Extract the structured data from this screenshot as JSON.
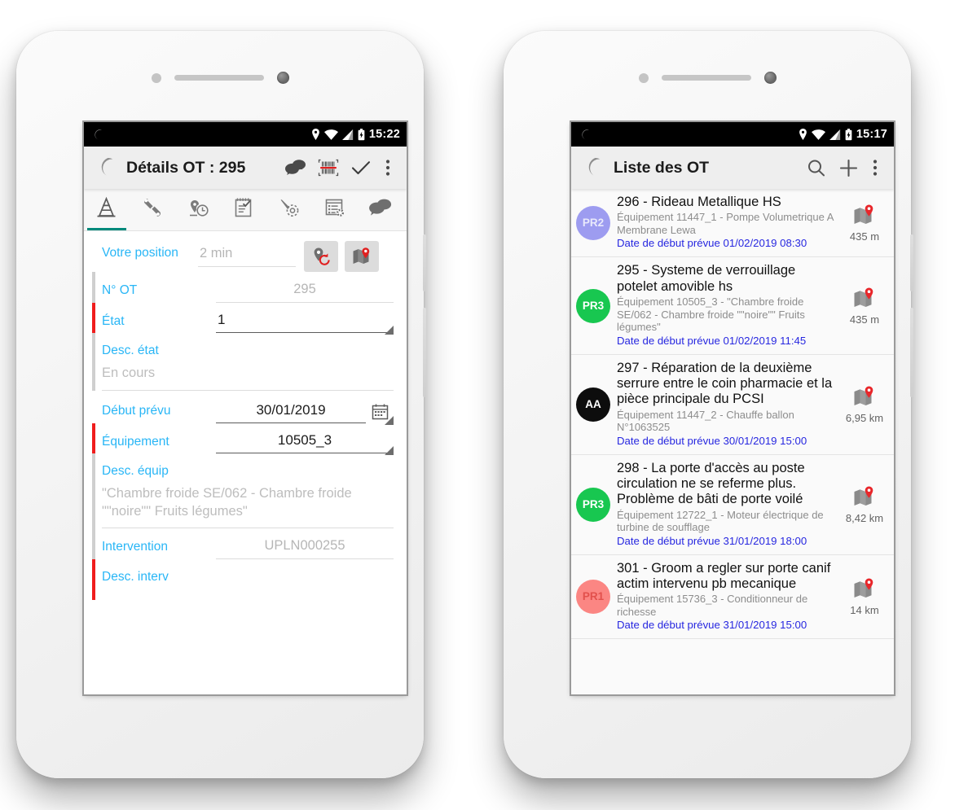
{
  "left_phone": {
    "status_bar": {
      "time": "15:22",
      "icons": [
        "location-pin",
        "wifi",
        "cellular-signal",
        "battery-charging"
      ]
    },
    "appbar": {
      "title": "Détails OT : 295",
      "actions": [
        {
          "name": "chat-icon",
          "label": "Chat"
        },
        {
          "name": "barcode-scan-icon",
          "label": "Scanner"
        },
        {
          "name": "check-icon",
          "label": "Valider"
        },
        {
          "name": "overflow-menu-icon",
          "label": "Plus"
        }
      ]
    },
    "tabs": [
      {
        "name": "tab-traffic-cone",
        "active": true
      },
      {
        "name": "tab-wrench",
        "active": false
      },
      {
        "name": "tab-location-history",
        "active": false
      },
      {
        "name": "tab-notepad",
        "active": false
      },
      {
        "name": "tab-tools",
        "active": false
      },
      {
        "name": "tab-list-settings",
        "active": false
      },
      {
        "name": "tab-chat",
        "active": false
      }
    ],
    "form": {
      "position": {
        "label": "Votre position",
        "value": "2 min",
        "refresh_button": "refresh-location-icon",
        "map_button": "map-pin-icon"
      },
      "fields": [
        {
          "label": "N° OT",
          "value": "295",
          "marker": "opt",
          "style": "ghost",
          "caret": false
        },
        {
          "label": "État",
          "value": "1",
          "marker": "req",
          "style": "value",
          "caret": true
        },
        {
          "label": "Début prévu",
          "value": "30/01/2019",
          "marker": "none",
          "style": "value",
          "caret": true,
          "calendar": true
        },
        {
          "label": "Équipement",
          "value": "10505_3",
          "marker": "req",
          "style": "value",
          "caret": true
        },
        {
          "label": "Intervention",
          "value": "UPLN000255",
          "marker": "opt",
          "style": "ghost",
          "caret": false
        }
      ],
      "desc_etat": {
        "label": "Desc. état",
        "value": "En cours",
        "marker": "opt"
      },
      "desc_equip": {
        "label": "Desc. équip",
        "value": "\"Chambre froide SE/062 - Chambre froide \"\"noire\"\" Fruits légumes\"",
        "marker": "opt"
      },
      "desc_interv": {
        "label": "Desc. interv",
        "marker": "req"
      }
    }
  },
  "right_phone": {
    "status_bar": {
      "time": "15:17",
      "icons": [
        "location-pin",
        "wifi",
        "cellular-signal",
        "battery-charging"
      ]
    },
    "appbar": {
      "title": "Liste des OT",
      "actions": [
        {
          "name": "search-icon",
          "label": "Rechercher"
        },
        {
          "name": "add-icon",
          "label": "Ajouter"
        },
        {
          "name": "overflow-menu-icon",
          "label": "Plus"
        }
      ]
    },
    "list": [
      {
        "avatar": "PR2",
        "avatar_bg": "#9d9cf0",
        "avatar_fg": "#e9e9fb",
        "title": "296 - Rideau Metallique HS",
        "equipment": "Équipement 11447_1 - Pompe Volumetrique A Membrane Lewa",
        "date": "Date de début prévue 01/02/2019 08:30",
        "distance": "435 m"
      },
      {
        "avatar": "PR3",
        "avatar_bg": "#18c750",
        "avatar_fg": "#ffffff",
        "title": "295 - Systeme de verrouillage potelet amovible hs",
        "equipment": "Équipement 10505_3 - \"Chambre froide SE/062 - Chambre froide \"\"noire\"\" Fruits légumes\"",
        "date": "Date de début prévue 01/02/2019 11:45",
        "distance": "435 m"
      },
      {
        "avatar": "AA",
        "avatar_bg": "#0d0d0d",
        "avatar_fg": "#ffffff",
        "title": "297 - Réparation de la deuxième serrure entre le coin pharmacie et la pièce principale du PCSI",
        "equipment": "Équipement 11447_2 - Chauffe ballon N°1063525",
        "date": "Date de début prévue 30/01/2019 15:00",
        "distance": "6,95 km"
      },
      {
        "avatar": "PR3",
        "avatar_bg": "#18c750",
        "avatar_fg": "#ffffff",
        "title": "298 - La porte d'accès au poste circulation ne se referme plus. Problème de bâti de porte voilé",
        "equipment": "Équipement 12722_1 - Moteur électrique de turbine de soufflage",
        "date": "Date de début prévue 31/01/2019 18:00",
        "distance": "8,42 km"
      },
      {
        "avatar": "PR1",
        "avatar_bg": "#fb8683",
        "avatar_fg": "#e2504c",
        "title": "301 - Groom a regler sur porte canif actim intervenu pb mecanique",
        "equipment": "Équipement 15736_3 - Conditionneur de richesse",
        "date": "Date de début prévue 31/01/2019 15:00",
        "distance": "14 km"
      }
    ]
  },
  "colors": {
    "accent_blue": "#29b6f6",
    "required_red": "#f01d1d",
    "tab_indicator": "#00897b",
    "date_blue": "#2727e0",
    "logo_blue": "#2196cd"
  }
}
